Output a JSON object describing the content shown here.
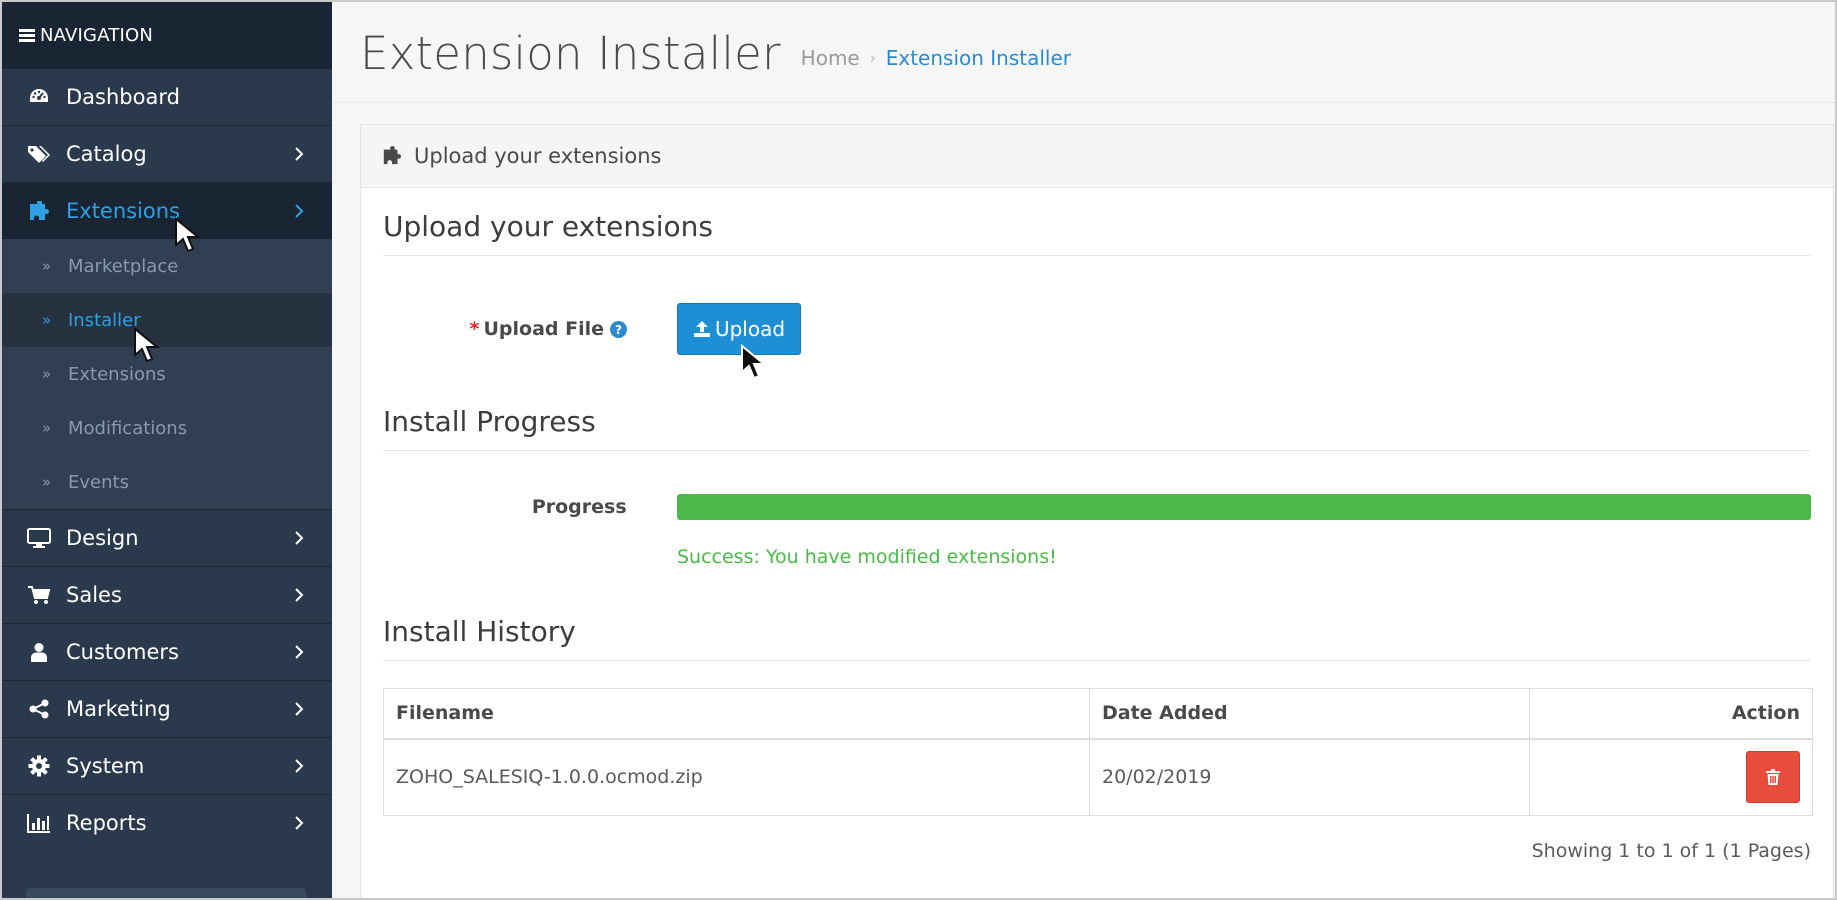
{
  "sidebar": {
    "header": "NAVIGATION",
    "items": [
      {
        "label": "Dashboard",
        "icon": "dashboard-icon",
        "chevron": false
      },
      {
        "label": "Catalog",
        "icon": "tags-icon",
        "chevron": true
      },
      {
        "label": "Extensions",
        "icon": "puzzle-icon",
        "chevron": true,
        "active": true
      },
      {
        "label": "Design",
        "icon": "monitor-icon",
        "chevron": true
      },
      {
        "label": "Sales",
        "icon": "cart-icon",
        "chevron": true
      },
      {
        "label": "Customers",
        "icon": "user-icon",
        "chevron": true
      },
      {
        "label": "Marketing",
        "icon": "share-icon",
        "chevron": true
      },
      {
        "label": "System",
        "icon": "gear-icon",
        "chevron": true
      },
      {
        "label": "Reports",
        "icon": "bar-chart-icon",
        "chevron": true
      }
    ],
    "sub_items": [
      {
        "label": "Marketplace"
      },
      {
        "label": "Installer",
        "active": true
      },
      {
        "label": "Extensions"
      },
      {
        "label": "Modifications"
      },
      {
        "label": "Events"
      }
    ]
  },
  "header": {
    "title": "Extension Installer",
    "breadcrumb": [
      "Home",
      "Extension Installer"
    ],
    "breadcrumb_sep": "›"
  },
  "panel": {
    "heading": "Upload your extensions",
    "upload_section": {
      "legend": "Upload your extensions",
      "required_mark": "*",
      "label": "Upload File",
      "help": "?",
      "button": "Upload"
    },
    "progress_section": {
      "legend": "Install Progress",
      "label": "Progress",
      "progress_percent": 100,
      "message": "Success: You have modified extensions!"
    },
    "history_section": {
      "legend": "Install History",
      "columns": [
        "Filename",
        "Date Added",
        "Action"
      ],
      "rows": [
        {
          "filename": "ZOHO_SALESIQ-1.0.0.ocmod.zip",
          "date_added": "20/02/2019"
        }
      ],
      "pagination": "Showing 1 to 1 of 1 (1 Pages)"
    }
  },
  "colors": {
    "sidebar_bg": "#2a3a4c",
    "accent": "#2ea0e4",
    "primary_button": "#1e8fd5",
    "success": "#4cb84a",
    "danger": "#e74c3c"
  }
}
